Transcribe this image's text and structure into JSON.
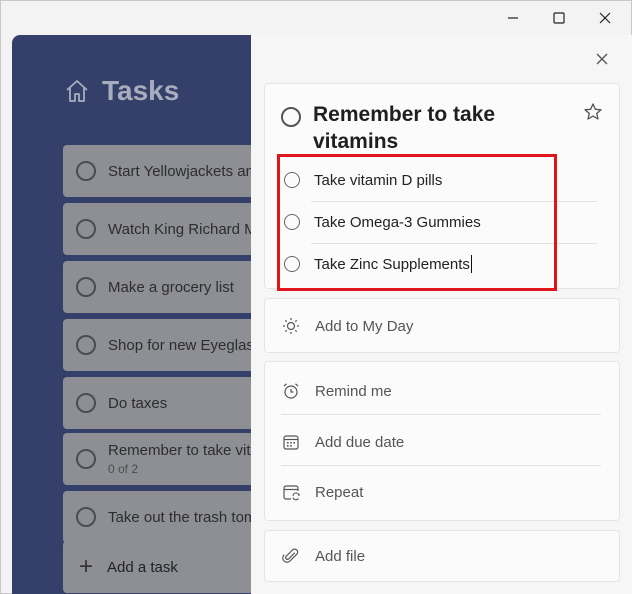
{
  "sidebar": {
    "title": "Tasks",
    "tasks": [
      {
        "label": "Start Yellowjackets and",
        "sub": ""
      },
      {
        "label": "Watch King Richard M",
        "sub": ""
      },
      {
        "label": "Make a grocery list",
        "sub": ""
      },
      {
        "label": "Shop for new Eyeglass",
        "sub": ""
      },
      {
        "label": "Do taxes",
        "sub": ""
      },
      {
        "label": "Remember to take vita",
        "sub": "0 of 2"
      },
      {
        "label": "Take out the trash tom",
        "sub": ""
      }
    ],
    "add_task_label": "Add a task"
  },
  "detail": {
    "task_title": "Remember to take vitamins",
    "steps": [
      {
        "label": "Take vitamin D pills"
      },
      {
        "label": "Take Omega-3 Gummies"
      },
      {
        "label": "Take Zinc Supplements"
      }
    ],
    "add_to_my_day": "Add to My Day",
    "remind_me": "Remind me",
    "add_due_date": "Add due date",
    "repeat": "Repeat",
    "add_file": "Add file"
  },
  "colors": {
    "sidebar_bg": "#34406a",
    "highlight": "#e0141b"
  }
}
